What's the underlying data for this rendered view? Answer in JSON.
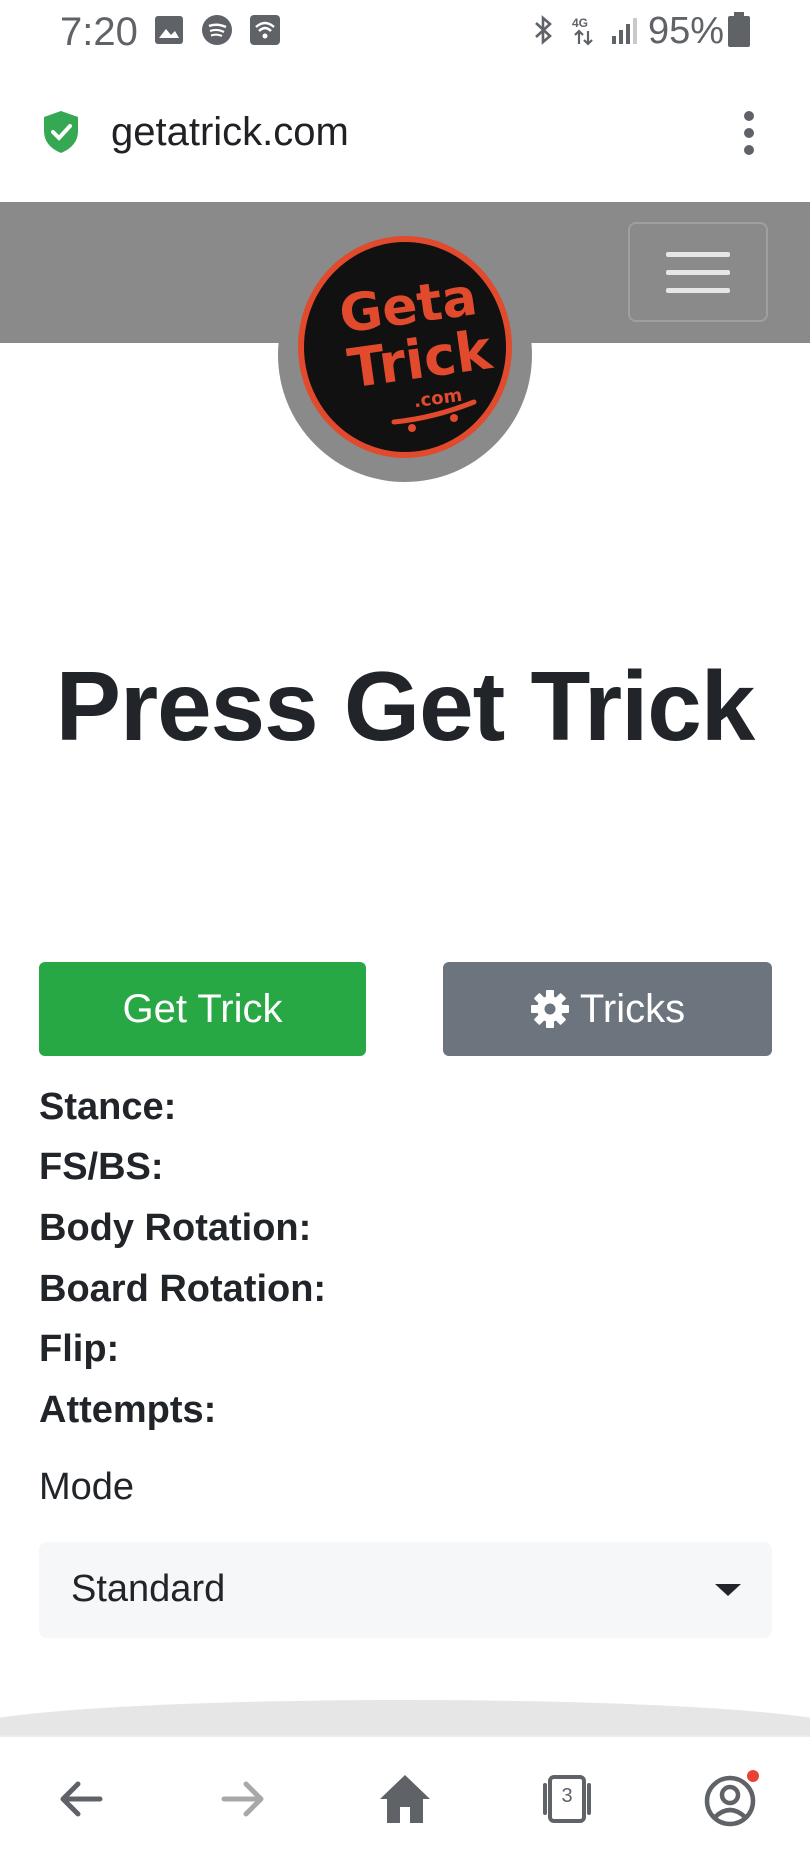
{
  "status_bar": {
    "time": "7:20",
    "battery": "95%",
    "network": "4G"
  },
  "browser": {
    "url": "getatrick.com"
  },
  "header": {
    "logo_text": "Geta Trick .com"
  },
  "main": {
    "heading": "Press Get Trick",
    "get_trick_label": "Get Trick",
    "tricks_label": "Tricks",
    "fields": [
      {
        "label": "Stance:"
      },
      {
        "label": "FS/BS:"
      },
      {
        "label": "Body Rotation:"
      },
      {
        "label": "Board Rotation:"
      },
      {
        "label": "Flip:"
      },
      {
        "label": "Attempts:"
      }
    ],
    "mode_label": "Mode",
    "mode_selected": "Standard"
  },
  "bottom_nav": {
    "tab_count": "3"
  },
  "colors": {
    "green": "#28a745",
    "gray_button": "#6c757d",
    "header_gray": "#8a8a8a",
    "logo_red": "#e14a2c"
  }
}
